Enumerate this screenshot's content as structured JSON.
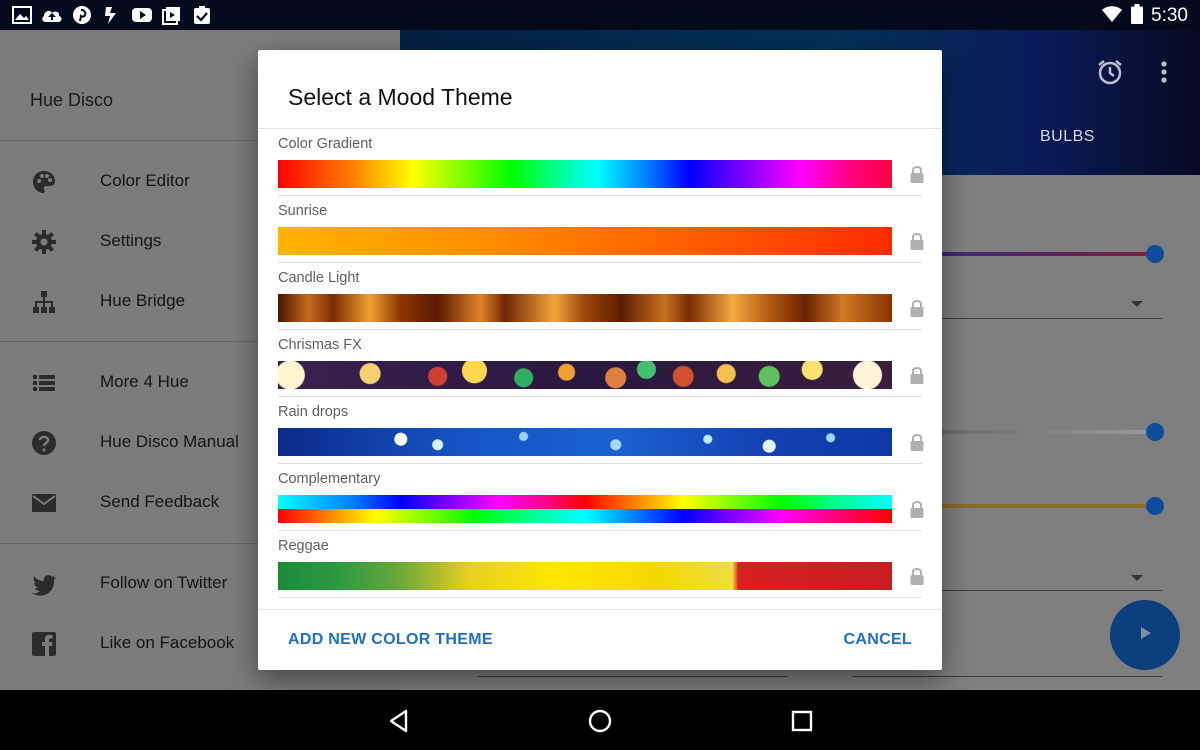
{
  "status_bar": {
    "time": "5:30",
    "left_icons": [
      "image-icon",
      "cloud-upload-icon",
      "pinterest-icon",
      "bolt-icon",
      "youtube-icon",
      "gallery-icon",
      "clipboard-check-icon"
    ],
    "right_icons": [
      "wifi-icon",
      "battery-icon"
    ]
  },
  "drawer": {
    "header": "Hue Disco",
    "items": [
      {
        "label": "Color Editor",
        "icon": "palette-icon"
      },
      {
        "label": "Settings",
        "icon": "gear-icon"
      },
      {
        "label": "Hue Bridge",
        "icon": "network-icon"
      },
      {
        "label": "More 4 Hue",
        "icon": "list-icon"
      },
      {
        "label": "Hue Disco Manual",
        "icon": "help-icon"
      },
      {
        "label": "Send Feedback",
        "icon": "mail-icon"
      },
      {
        "label": "Follow on Twitter",
        "icon": "twitter-icon"
      },
      {
        "label": "Like on Facebook",
        "icon": "facebook-icon"
      }
    ]
  },
  "main": {
    "tab_bulbs": "BULBS",
    "icons": [
      "alarm-icon",
      "more-vert-icon"
    ],
    "accent": "#0d4d9b"
  },
  "dialog": {
    "title": "Select a Mood Theme",
    "themes": [
      {
        "name": "Color Gradient",
        "locked": true
      },
      {
        "name": "Sunrise",
        "locked": true
      },
      {
        "name": "Candle Light",
        "locked": true
      },
      {
        "name": "Chrismas FX",
        "locked": true
      },
      {
        "name": "Rain drops",
        "locked": true
      },
      {
        "name": "Complementary",
        "locked": true
      },
      {
        "name": "Reggae",
        "locked": true
      }
    ],
    "add_button": "ADD NEW COLOR THEME",
    "cancel_button": "CANCEL",
    "action_color": "#1f6fc6"
  },
  "nav_bar": {
    "icons": [
      "back-icon",
      "home-icon",
      "recents-icon"
    ]
  }
}
